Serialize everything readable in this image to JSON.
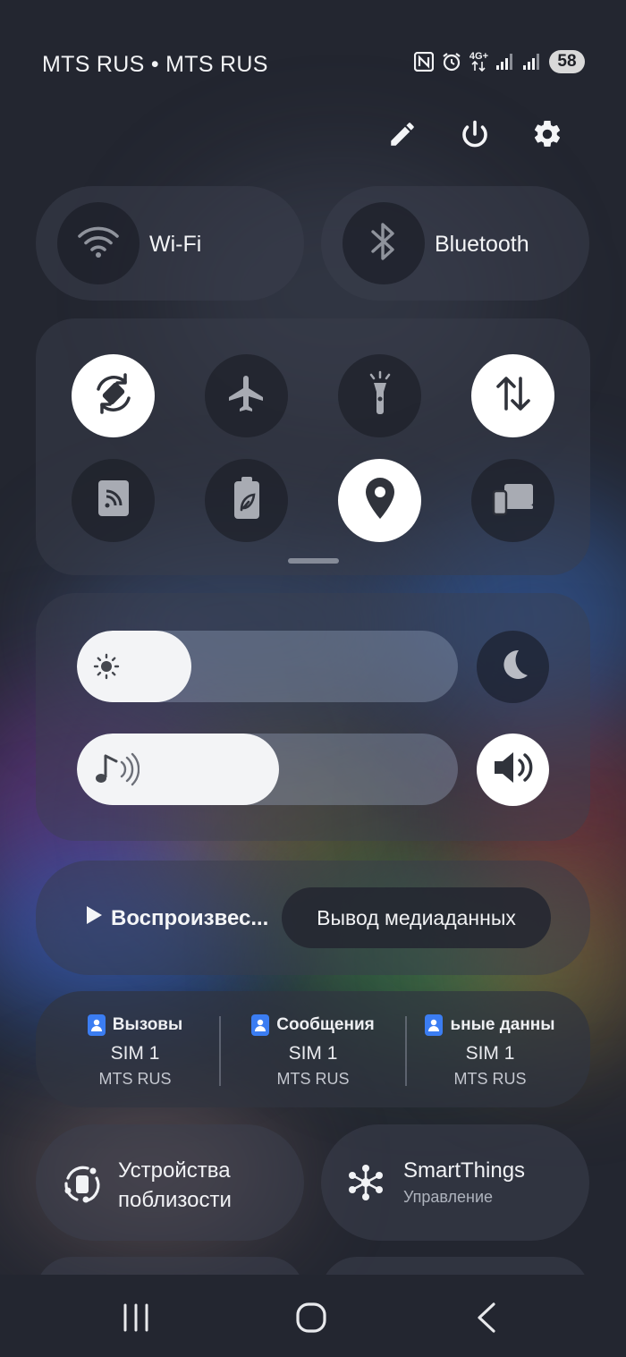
{
  "status_bar": {
    "carrier": "MTS RUS • MTS RUS",
    "network_type": "4G+",
    "battery": "58",
    "icons": [
      "nfc-icon",
      "alarm-icon",
      "data-arrows-icon",
      "signal-sim1-icon",
      "signal-sim2-icon"
    ]
  },
  "toolbar": {
    "icons": [
      "edit-pencil-icon",
      "power-icon",
      "settings-gear-icon"
    ]
  },
  "connectivity": {
    "wifi": {
      "label": "Wi-Fi",
      "icon": "wifi-icon",
      "active": false
    },
    "bluetooth": {
      "label": "Bluetooth",
      "icon": "bluetooth-icon",
      "active": false
    }
  },
  "quick_toggles": [
    {
      "icon": "auto-rotate-icon",
      "active": true
    },
    {
      "icon": "airplane-icon",
      "active": false
    },
    {
      "icon": "flashlight-icon",
      "active": false
    },
    {
      "icon": "mobile-data-icon",
      "active": true
    },
    {
      "icon": "nfc-tile-icon",
      "active": false
    },
    {
      "icon": "power-saving-icon",
      "active": false
    },
    {
      "icon": "location-icon",
      "active": true
    },
    {
      "icon": "link-to-windows-icon",
      "active": false
    }
  ],
  "sliders": {
    "brightness": {
      "icon": "sun-icon",
      "level_pct": 30
    },
    "volume": {
      "icon": "music-note-icon",
      "level_pct": 53
    },
    "dark_mode_icon": "moon-icon",
    "sound_mode_icon": "speaker-icon"
  },
  "media": {
    "play_label": "Воспроизвес...",
    "output_label": "Вывод медиаданных"
  },
  "sim": [
    {
      "title": "Вызовы",
      "sim": "SIM 1",
      "carrier": "MTS RUS"
    },
    {
      "title": "Сообщения",
      "sim": "SIM 1",
      "carrier": "MTS RUS"
    },
    {
      "title": "ьные данны",
      "sim": "SIM 1",
      "carrier": "MTS RUS"
    }
  ],
  "bottom_tiles": {
    "nearby": {
      "line1": "Устройства",
      "line2": "поблизости",
      "icon": "nearby-devices-icon"
    },
    "smartthings": {
      "title": "SmartThings",
      "subtitle": "Управление",
      "icon": "smartthings-icon"
    }
  },
  "nav": {
    "icons": [
      "recents-icon",
      "home-icon",
      "back-icon"
    ]
  },
  "colors": {
    "accent_sim": "#3b7df2",
    "smartthings_subtitle": "#aeb3bd"
  }
}
